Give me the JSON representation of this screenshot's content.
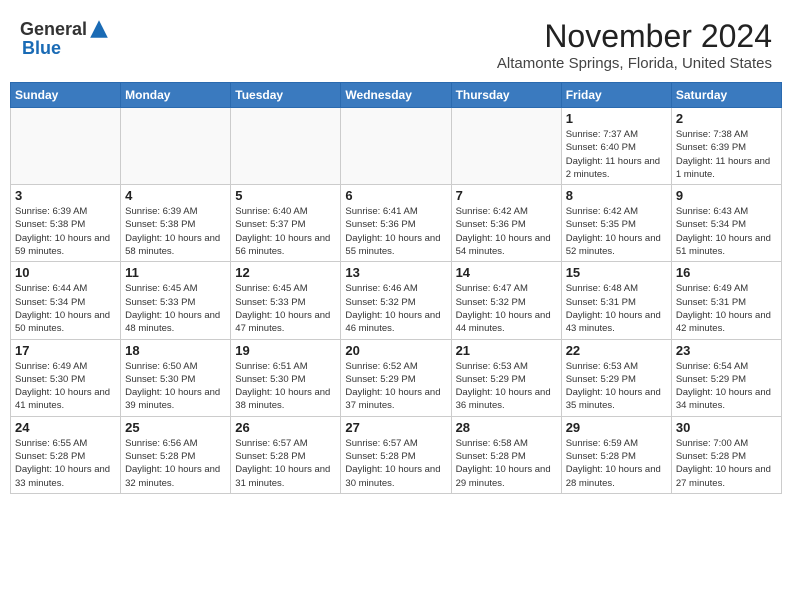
{
  "header": {
    "logo_general": "General",
    "logo_blue": "Blue",
    "month_title": "November 2024",
    "location": "Altamonte Springs, Florida, United States"
  },
  "weekdays": [
    "Sunday",
    "Monday",
    "Tuesday",
    "Wednesday",
    "Thursday",
    "Friday",
    "Saturday"
  ],
  "weeks": [
    [
      {
        "day": "",
        "sunrise": "",
        "sunset": "",
        "daylight": ""
      },
      {
        "day": "",
        "sunrise": "",
        "sunset": "",
        "daylight": ""
      },
      {
        "day": "",
        "sunrise": "",
        "sunset": "",
        "daylight": ""
      },
      {
        "day": "",
        "sunrise": "",
        "sunset": "",
        "daylight": ""
      },
      {
        "day": "",
        "sunrise": "",
        "sunset": "",
        "daylight": ""
      },
      {
        "day": "1",
        "sunrise": "Sunrise: 7:37 AM",
        "sunset": "Sunset: 6:40 PM",
        "daylight": "Daylight: 11 hours and 2 minutes."
      },
      {
        "day": "2",
        "sunrise": "Sunrise: 7:38 AM",
        "sunset": "Sunset: 6:39 PM",
        "daylight": "Daylight: 11 hours and 1 minute."
      }
    ],
    [
      {
        "day": "3",
        "sunrise": "Sunrise: 6:39 AM",
        "sunset": "Sunset: 5:38 PM",
        "daylight": "Daylight: 10 hours and 59 minutes."
      },
      {
        "day": "4",
        "sunrise": "Sunrise: 6:39 AM",
        "sunset": "Sunset: 5:38 PM",
        "daylight": "Daylight: 10 hours and 58 minutes."
      },
      {
        "day": "5",
        "sunrise": "Sunrise: 6:40 AM",
        "sunset": "Sunset: 5:37 PM",
        "daylight": "Daylight: 10 hours and 56 minutes."
      },
      {
        "day": "6",
        "sunrise": "Sunrise: 6:41 AM",
        "sunset": "Sunset: 5:36 PM",
        "daylight": "Daylight: 10 hours and 55 minutes."
      },
      {
        "day": "7",
        "sunrise": "Sunrise: 6:42 AM",
        "sunset": "Sunset: 5:36 PM",
        "daylight": "Daylight: 10 hours and 54 minutes."
      },
      {
        "day": "8",
        "sunrise": "Sunrise: 6:42 AM",
        "sunset": "Sunset: 5:35 PM",
        "daylight": "Daylight: 10 hours and 52 minutes."
      },
      {
        "day": "9",
        "sunrise": "Sunrise: 6:43 AM",
        "sunset": "Sunset: 5:34 PM",
        "daylight": "Daylight: 10 hours and 51 minutes."
      }
    ],
    [
      {
        "day": "10",
        "sunrise": "Sunrise: 6:44 AM",
        "sunset": "Sunset: 5:34 PM",
        "daylight": "Daylight: 10 hours and 50 minutes."
      },
      {
        "day": "11",
        "sunrise": "Sunrise: 6:45 AM",
        "sunset": "Sunset: 5:33 PM",
        "daylight": "Daylight: 10 hours and 48 minutes."
      },
      {
        "day": "12",
        "sunrise": "Sunrise: 6:45 AM",
        "sunset": "Sunset: 5:33 PM",
        "daylight": "Daylight: 10 hours and 47 minutes."
      },
      {
        "day": "13",
        "sunrise": "Sunrise: 6:46 AM",
        "sunset": "Sunset: 5:32 PM",
        "daylight": "Daylight: 10 hours and 46 minutes."
      },
      {
        "day": "14",
        "sunrise": "Sunrise: 6:47 AM",
        "sunset": "Sunset: 5:32 PM",
        "daylight": "Daylight: 10 hours and 44 minutes."
      },
      {
        "day": "15",
        "sunrise": "Sunrise: 6:48 AM",
        "sunset": "Sunset: 5:31 PM",
        "daylight": "Daylight: 10 hours and 43 minutes."
      },
      {
        "day": "16",
        "sunrise": "Sunrise: 6:49 AM",
        "sunset": "Sunset: 5:31 PM",
        "daylight": "Daylight: 10 hours and 42 minutes."
      }
    ],
    [
      {
        "day": "17",
        "sunrise": "Sunrise: 6:49 AM",
        "sunset": "Sunset: 5:30 PM",
        "daylight": "Daylight: 10 hours and 41 minutes."
      },
      {
        "day": "18",
        "sunrise": "Sunrise: 6:50 AM",
        "sunset": "Sunset: 5:30 PM",
        "daylight": "Daylight: 10 hours and 39 minutes."
      },
      {
        "day": "19",
        "sunrise": "Sunrise: 6:51 AM",
        "sunset": "Sunset: 5:30 PM",
        "daylight": "Daylight: 10 hours and 38 minutes."
      },
      {
        "day": "20",
        "sunrise": "Sunrise: 6:52 AM",
        "sunset": "Sunset: 5:29 PM",
        "daylight": "Daylight: 10 hours and 37 minutes."
      },
      {
        "day": "21",
        "sunrise": "Sunrise: 6:53 AM",
        "sunset": "Sunset: 5:29 PM",
        "daylight": "Daylight: 10 hours and 36 minutes."
      },
      {
        "day": "22",
        "sunrise": "Sunrise: 6:53 AM",
        "sunset": "Sunset: 5:29 PM",
        "daylight": "Daylight: 10 hours and 35 minutes."
      },
      {
        "day": "23",
        "sunrise": "Sunrise: 6:54 AM",
        "sunset": "Sunset: 5:29 PM",
        "daylight": "Daylight: 10 hours and 34 minutes."
      }
    ],
    [
      {
        "day": "24",
        "sunrise": "Sunrise: 6:55 AM",
        "sunset": "Sunset: 5:28 PM",
        "daylight": "Daylight: 10 hours and 33 minutes."
      },
      {
        "day": "25",
        "sunrise": "Sunrise: 6:56 AM",
        "sunset": "Sunset: 5:28 PM",
        "daylight": "Daylight: 10 hours and 32 minutes."
      },
      {
        "day": "26",
        "sunrise": "Sunrise: 6:57 AM",
        "sunset": "Sunset: 5:28 PM",
        "daylight": "Daylight: 10 hours and 31 minutes."
      },
      {
        "day": "27",
        "sunrise": "Sunrise: 6:57 AM",
        "sunset": "Sunset: 5:28 PM",
        "daylight": "Daylight: 10 hours and 30 minutes."
      },
      {
        "day": "28",
        "sunrise": "Sunrise: 6:58 AM",
        "sunset": "Sunset: 5:28 PM",
        "daylight": "Daylight: 10 hours and 29 minutes."
      },
      {
        "day": "29",
        "sunrise": "Sunrise: 6:59 AM",
        "sunset": "Sunset: 5:28 PM",
        "daylight": "Daylight: 10 hours and 28 minutes."
      },
      {
        "day": "30",
        "sunrise": "Sunrise: 7:00 AM",
        "sunset": "Sunset: 5:28 PM",
        "daylight": "Daylight: 10 hours and 27 minutes."
      }
    ]
  ]
}
